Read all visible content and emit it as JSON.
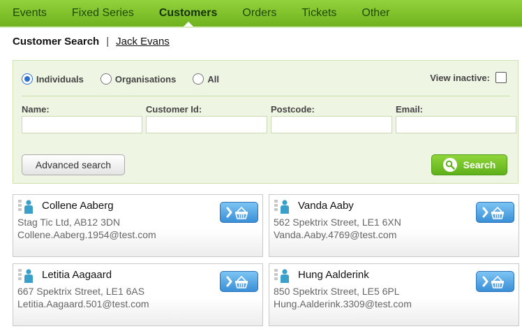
{
  "nav": {
    "items": [
      {
        "label": "Events"
      },
      {
        "label": "Fixed Series"
      },
      {
        "label": "Customers"
      },
      {
        "label": "Orders"
      },
      {
        "label": "Tickets"
      },
      {
        "label": "Other"
      }
    ],
    "active": "Customers"
  },
  "breadcrumb": {
    "current": "Customer Search",
    "separator": "|",
    "link": "Jack Evans"
  },
  "search": {
    "radios": [
      {
        "label": "Individuals",
        "checked": true
      },
      {
        "label": "Organisations",
        "checked": false
      },
      {
        "label": "All",
        "checked": false
      }
    ],
    "view_inactive_label": "View inactive:",
    "view_inactive_checked": false,
    "fields": [
      {
        "label": "Name:",
        "value": ""
      },
      {
        "label": "Customer Id:",
        "value": ""
      },
      {
        "label": "Postcode:",
        "value": ""
      },
      {
        "label": "Email:",
        "value": ""
      }
    ],
    "advanced_label": "Advanced search",
    "search_label": "Search"
  },
  "customers": [
    {
      "name": "Collene Aaberg",
      "address": "Stag Tic Ltd, AB12 3DN",
      "email": "Collene.Aaberg.1954@test.com"
    },
    {
      "name": "Vanda Aaby",
      "address": "562 Spektrix Street, LE1 6XN",
      "email": "Vanda.Aaby.4769@test.com"
    },
    {
      "name": "Letitia Aagaard",
      "address": "667 Spektrix Street, LE1 6AS",
      "email": "Letitia.Aagaard.501@test.com"
    },
    {
      "name": "Hung Aalderink",
      "address": "850 Spektrix Street, LE5 6PL",
      "email": "Hung.Aalderink.3309@test.com"
    }
  ],
  "colors": {
    "nav_green": "#7fc22a",
    "search_green": "#6cbb24",
    "basket_blue": "#3a8fd6",
    "panel_bg": "#eef5e2"
  }
}
